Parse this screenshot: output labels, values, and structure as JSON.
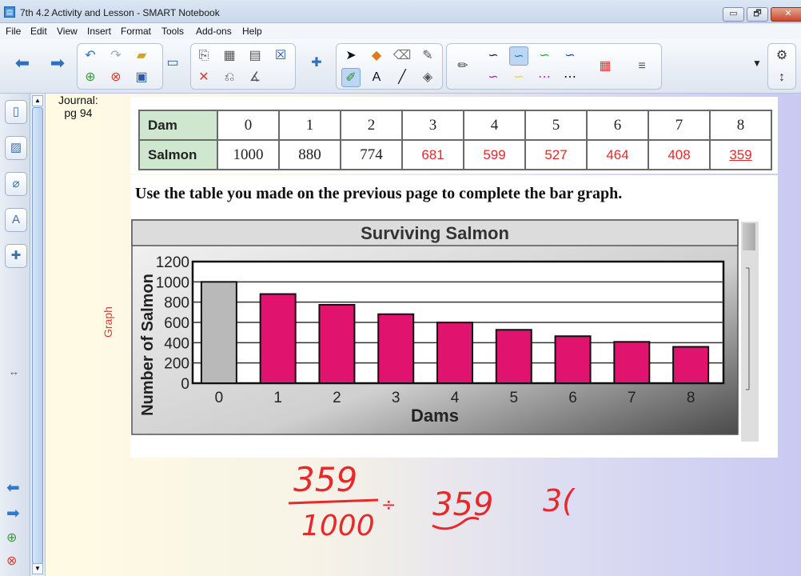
{
  "window": {
    "title": "7th 4.2 Activity and Lesson - SMART Notebook",
    "buttons": {
      "minimize": "▭",
      "restore": "🗗",
      "close": "✕"
    }
  },
  "menu": [
    "File",
    "Edit",
    "View",
    "Insert",
    "Format",
    "Tools",
    "Add-ons",
    "Help"
  ],
  "sidebar": {
    "tabs": [
      "page-sorter-icon",
      "gallery-icon",
      "attachments-icon",
      "properties-icon",
      "add-ons-icon"
    ],
    "resize_handle": "↔"
  },
  "page": {
    "journal_label": "Journal:\npg 94",
    "graph_label": "Graph",
    "instruction": "Use the table you made on the previous page to complete the bar graph."
  },
  "table": {
    "row1_label": "Dam",
    "row2_label": "Salmon",
    "dams": [
      "0",
      "1",
      "2",
      "3",
      "4",
      "5",
      "6",
      "7",
      "8"
    ],
    "salmon": [
      "1000",
      "880",
      "774",
      "681",
      "599",
      "527",
      "464",
      "408",
      "359"
    ],
    "salmon_handwritten_from_index": 3
  },
  "chart_data": {
    "type": "bar",
    "title": "Surviving Salmon",
    "xlabel": "Dams",
    "ylabel": "Number of Salmon",
    "categories": [
      "0",
      "1",
      "2",
      "3",
      "4",
      "5",
      "6",
      "7",
      "8"
    ],
    "values": [
      1000,
      880,
      774,
      681,
      599,
      527,
      464,
      408,
      359
    ],
    "bar_colors": [
      "#b9b9b9",
      "#e0136f",
      "#e0136f",
      "#e0136f",
      "#e0136f",
      "#e0136f",
      "#e0136f",
      "#e0136f",
      "#e0136f"
    ],
    "yticks": [
      "0",
      "200",
      "400",
      "600",
      "800",
      "1000",
      "1200"
    ],
    "ylim": [
      0,
      1200
    ],
    "grid": true
  },
  "handwriting": {
    "numerator": "359",
    "denominator": "1000",
    "operator": "÷",
    "result": "359",
    "partial": "3("
  },
  "colors": {
    "ink_red": "#e8292b",
    "bar_pink": "#e0136f",
    "bar_gray": "#b9b9b9"
  }
}
